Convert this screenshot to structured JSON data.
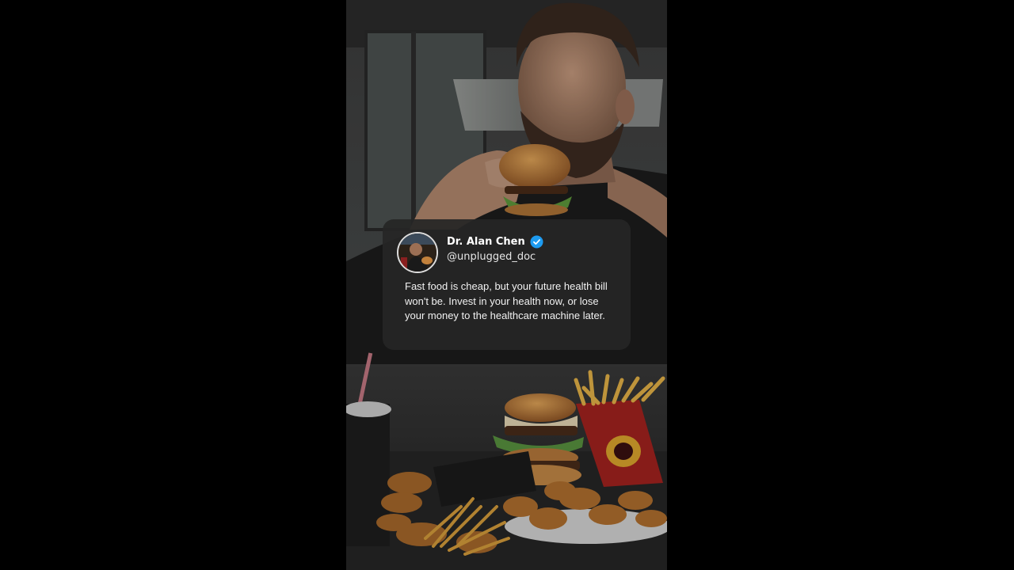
{
  "post": {
    "author_name": "Dr. Alan Chen",
    "author_handle": "@unplugged_doc",
    "verified": true,
    "text": "Fast food is cheap, but your future health bill won't be. Invest in your health now, or lose your money to the healthcare machine later."
  },
  "colors": {
    "page_background": "#000000",
    "card_background": "#262626",
    "verified_badge": "#1d9bf0"
  }
}
